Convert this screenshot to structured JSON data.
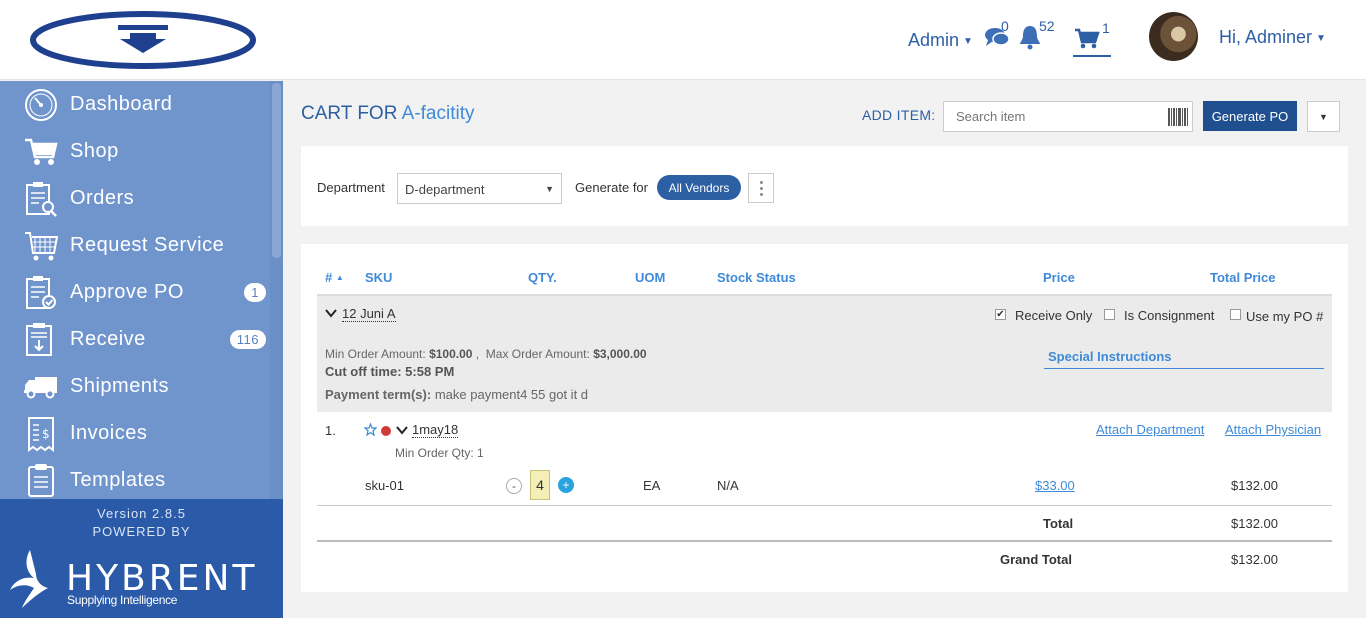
{
  "header": {
    "admin_label": "Admin",
    "chat_count": "0",
    "notification_count": "52",
    "cart_count": "1",
    "greeting": "Hi, Adminer",
    "accent_color": "#2d5fa5"
  },
  "sidebar": {
    "items": [
      {
        "label": "Dashboard",
        "icon": "dashboard-icon"
      },
      {
        "label": "Shop",
        "icon": "cart-icon"
      },
      {
        "label": "Orders",
        "icon": "orders-icon"
      },
      {
        "label": "Request Service",
        "icon": "request-service-icon"
      },
      {
        "label": "Approve PO",
        "icon": "approve-po-icon",
        "badge": "1"
      },
      {
        "label": "Receive",
        "icon": "receive-icon",
        "badge": "116"
      },
      {
        "label": "Shipments",
        "icon": "truck-icon"
      },
      {
        "label": "Invoices",
        "icon": "invoice-icon"
      },
      {
        "label": "Templates",
        "icon": "templates-icon"
      }
    ],
    "version": "Version 2.8.5",
    "powered_by": "POWERED BY",
    "brand": "HYBRENT",
    "tagline": "Supplying Intelligence",
    "bg_color": "#7095cd",
    "footer_color": "#2a5aa8"
  },
  "page": {
    "title_prefix": "CART FOR",
    "facility": "A-facitity",
    "add_item_label": "ADD ITEM:",
    "search_placeholder": "Search item",
    "generate_po": "Generate PO"
  },
  "filters": {
    "department_label": "Department",
    "department_value": "D-department",
    "generate_for_label": "Generate for",
    "generate_for_value": "All Vendors"
  },
  "table": {
    "headers": {
      "num": "#",
      "sku": "SKU",
      "qty": "QTY.",
      "uom": "UOM",
      "stock": "Stock Status",
      "price": "Price",
      "total": "Total Price"
    },
    "group": {
      "vendor": "12 Juni A",
      "receive_only": "Receive Only",
      "is_consignment": "Is Consignment",
      "use_my_po": "Use my PO #",
      "min_order_label": "Min Order Amount:",
      "min_order_value": "$100.00",
      "max_order_label": "Max Order Amount:",
      "max_order_value": "$3,000.00",
      "cutoff_label": "Cut off time:",
      "cutoff_value": "5:58 PM",
      "payment_label": "Payment term(s):",
      "payment_value": "make payment4 55 got it d",
      "special_instructions": "Special Instructions"
    },
    "rows": [
      {
        "index": "1.",
        "name": "1may18",
        "min_order_qty": "Min Order Qty: 1",
        "attach_department": "Attach Department",
        "attach_physician": "Attach Physician",
        "sku": "sku-01",
        "qty": "4",
        "uom": "EA",
        "stock": "N/A",
        "price": "$33.00",
        "total": "$132.00"
      }
    ],
    "total_label": "Total",
    "total_value": "$132.00",
    "grand_total_label": "Grand Total",
    "grand_total_value": "$132.00"
  }
}
